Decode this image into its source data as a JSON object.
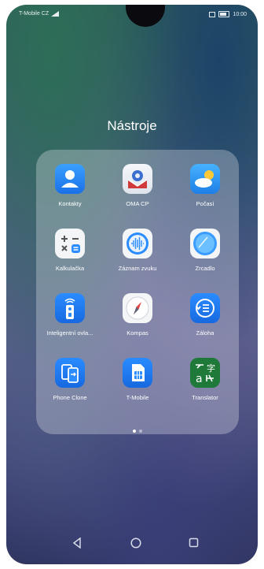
{
  "status_bar": {
    "carrier": "T-Mobile CZ",
    "time": "10:00"
  },
  "folder": {
    "title": "Nástroje",
    "apps": [
      {
        "label": "Kontakty",
        "icon": "contacts-icon"
      },
      {
        "label": "OMA CP",
        "icon": "oma-cp-icon"
      },
      {
        "label": "Počasí",
        "icon": "weather-icon"
      },
      {
        "label": "Kalkulačka",
        "icon": "calculator-icon"
      },
      {
        "label": "Záznam zvuku",
        "icon": "sound-recorder-icon"
      },
      {
        "label": "Zrcadlo",
        "icon": "mirror-icon"
      },
      {
        "label": "Inteligentní ovla...",
        "icon": "smart-remote-icon"
      },
      {
        "label": "Kompas",
        "icon": "compass-icon"
      },
      {
        "label": "Záloha",
        "icon": "backup-icon"
      },
      {
        "label": "Phone Clone",
        "icon": "phone-clone-icon"
      },
      {
        "label": "T-Mobile",
        "icon": "sim-card-icon"
      },
      {
        "label": "Translator",
        "icon": "translator-icon"
      }
    ],
    "page_count": 2,
    "current_page": 1
  },
  "nav_bar": {
    "buttons": [
      "back",
      "home",
      "recents"
    ]
  }
}
